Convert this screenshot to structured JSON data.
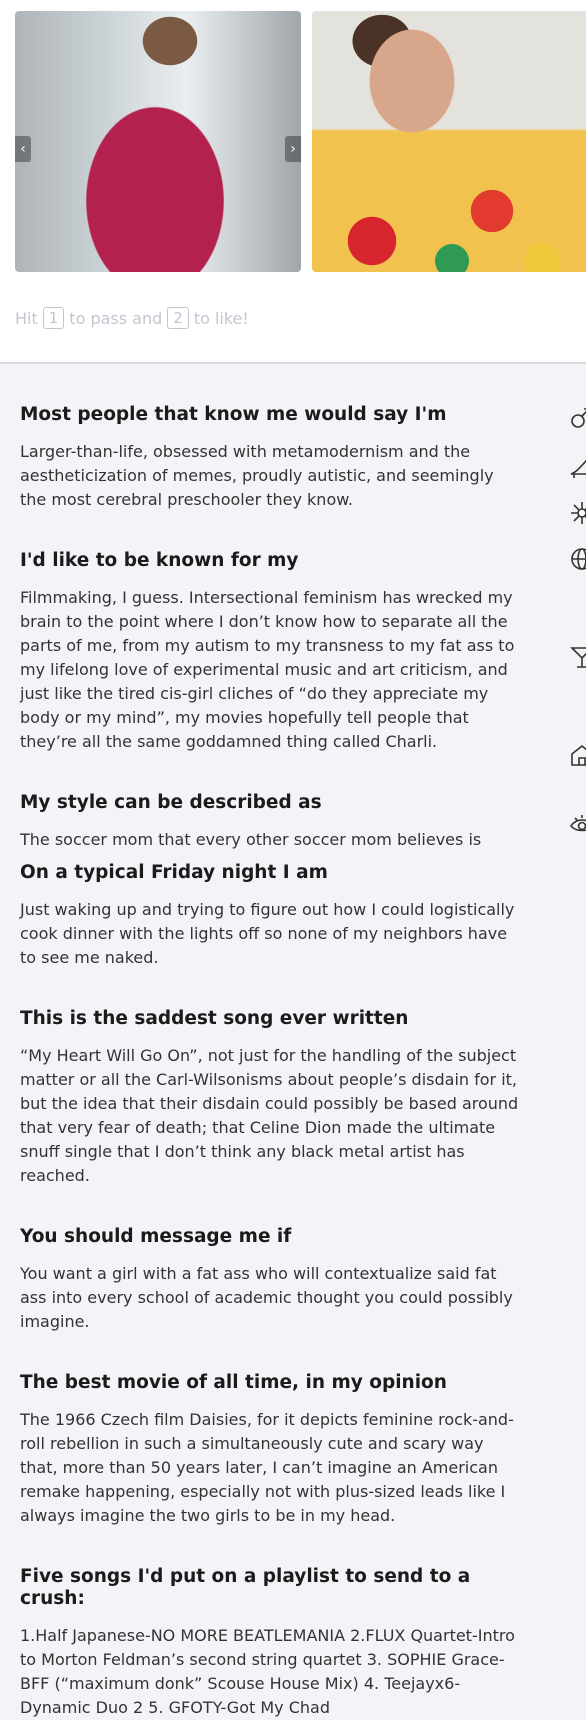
{
  "carousel": {
    "prev_label": "‹",
    "next_label": "›"
  },
  "hint": {
    "prefix": "Hit",
    "key_pass": "1",
    "middle": "to pass and",
    "key_like": "2",
    "suffix": "to like!"
  },
  "sections": [
    {
      "title": "Most people that know me would say I'm",
      "text": "Larger-than-life, obsessed with metamodernism and the aestheticization of memes, proudly autistic, and seemingly the most cerebral preschooler they know."
    },
    {
      "title": "I'd like to be known for my",
      "text": "Filmmaking, I guess. Intersectional feminism has wrecked my brain to the point where I don’t know how to separate all the parts of me, from my autism to my transness to my fat ass to my lifelong love of experimental music and art criticism, and just like the tired cis-girl cliches of “do they appreciate my body or my mind”, my movies hopefully tell people that they’re all the same goddamned thing called Charli."
    },
    {
      "title": "My style can be described as",
      "text": "The soccer mom that every other soccer mom believes is"
    },
    {
      "title": "On a typical Friday night I am",
      "text": "Just waking up and trying to figure out how I could logistically cook dinner with the lights off so none of my neighbors have to see me naked."
    },
    {
      "title": "This is the saddest song ever written",
      "text": "“My Heart Will Go On”, not just for the handling of the subject matter or all the Carl-Wilsonisms about people’s disdain for it, but the idea that their disdain could possibly be based around that very fear of death; that Celine Dion made the ultimate snuff single that I don’t think any black metal artist has reached."
    },
    {
      "title": "You should message me if",
      "text": "You want a girl with a fat ass who will contextualize said fat ass into every school of academic thought you could possibly imagine."
    },
    {
      "title": "The best movie of all time, in my opinion",
      "text": "The 1966 Czech film Daisies, for it depicts feminine rock-and-roll rebellion in such a simultaneously cute and scary way that, more than 50 years later, I can’t imagine an American remake happening, especially not with plus-sized leads like I always imagine the two girls to be in my head."
    },
    {
      "title": "Five songs I'd put on a playlist to send to a crush:",
      "text": "1.Half Japanese-NO MORE BEATLEMANIA 2.FLUX Quartet-Intro to Morton Feldman’s second string quartet 3. SOPHIE Grace-BFF (“maximum donk” Scouse House Mix) 4. Teejayx6-Dynamic Duo 2 5. GFOTY-Got My Chad"
    }
  ],
  "side_icons": [
    "gender-icon",
    "heel-icon",
    "sparkle-icon",
    "globe-icon",
    "cocktail-icon",
    "house-icon",
    "eye-icon"
  ]
}
